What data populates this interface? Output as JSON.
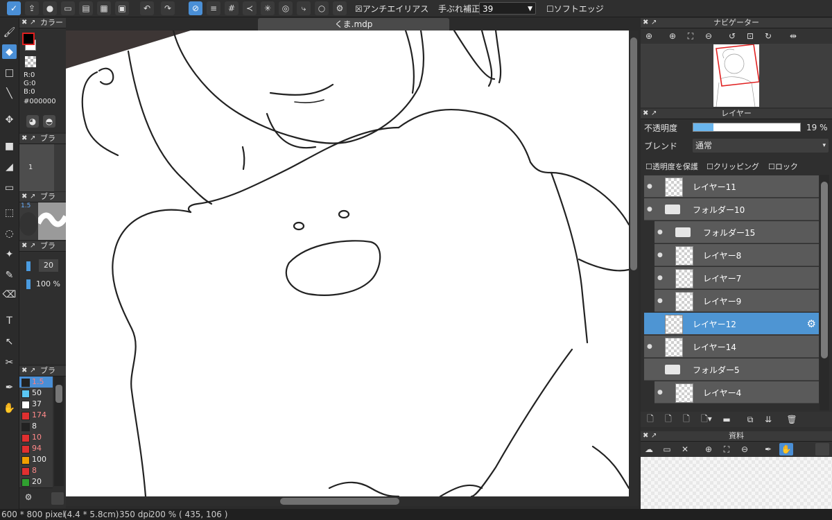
{
  "toolbar": {
    "antialias_label": "アンチエイリアス",
    "stabilizer_label": "手ぶれ補正",
    "stabilizer_value": "39",
    "soft_edge_label": "ソフトエッジ"
  },
  "document_tab": {
    "title": "くま.mdp"
  },
  "color_panel": {
    "title": "カラー",
    "r": "R:0",
    "g": "G:0",
    "b": "B:0",
    "hex": "#000000",
    "fg_color": "#000000",
    "bg_color": "#ffffff"
  },
  "brush_panels": {
    "title_1": "ブラ",
    "title_2": "ブラ",
    "title_3": "ブラ",
    "title_4": "ブラ",
    "size_marker": "1",
    "preview_label": "1.5",
    "size_value": "20",
    "opacity_value": "100 %"
  },
  "brush_list": [
    {
      "value": "1.5",
      "color": "#222222"
    },
    {
      "value": "50",
      "color": "#5bc8f5"
    },
    {
      "value": "37",
      "color": "#ffffff"
    },
    {
      "value": "174",
      "color": "#e03030"
    },
    {
      "value": "8",
      "color": "#222222"
    },
    {
      "value": "10",
      "color": "#e03030"
    },
    {
      "value": "94",
      "color": "#e03030"
    },
    {
      "value": "100",
      "color": "#f0a000"
    },
    {
      "value": "8",
      "color": "#e03030"
    },
    {
      "value": "20",
      "color": "#30a030"
    }
  ],
  "navigator": {
    "title": "ナビゲーター"
  },
  "layers_panel": {
    "title": "レイヤー",
    "opacity_label": "不透明度",
    "opacity_value": "19 %",
    "opacity_fraction": 0.19,
    "blend_label": "ブレンド",
    "blend_value": "通常",
    "protect_alpha": "透明度を保護",
    "clipping": "クリッピング",
    "lock": "ロック",
    "layers": [
      {
        "name": "レイヤー11",
        "kind": "layer",
        "indent": 0,
        "visible": true,
        "selected": false
      },
      {
        "name": "フォルダー10",
        "kind": "folder",
        "indent": 0,
        "visible": true,
        "selected": false
      },
      {
        "name": "フォルダー15",
        "kind": "folder",
        "indent": 1,
        "visible": true,
        "selected": false
      },
      {
        "name": "レイヤー8",
        "kind": "layer",
        "indent": 1,
        "visible": true,
        "selected": false
      },
      {
        "name": "レイヤー7",
        "kind": "layer",
        "indent": 1,
        "visible": true,
        "selected": false
      },
      {
        "name": "レイヤー9",
        "kind": "layer",
        "indent": 1,
        "visible": true,
        "selected": false
      },
      {
        "name": "レイヤー12",
        "kind": "layer",
        "indent": 0,
        "visible": false,
        "selected": true
      },
      {
        "name": "レイヤー14",
        "kind": "layer",
        "indent": 0,
        "visible": true,
        "selected": false
      },
      {
        "name": "フォルダー5",
        "kind": "folder",
        "indent": 0,
        "visible": false,
        "selected": false
      },
      {
        "name": "レイヤー4",
        "kind": "layer",
        "indent": 1,
        "visible": true,
        "selected": false
      }
    ]
  },
  "materials": {
    "title": "資料"
  },
  "status": {
    "size": "600 * 800 pixel",
    "physical": "(4.4 * 5.8cm)",
    "dpi": "350 dpi",
    "zoom": "200 %",
    "cursor": "( 435, 106 )"
  },
  "icons": [
    "medibang-logo",
    "share-icon",
    "speech-bubble-icon",
    "comment-icon",
    "page-icon",
    "panels-icon",
    "grid-icon",
    "undo-icon",
    "redo-icon",
    "snap-off-icon",
    "parallel-snap-icon",
    "grid-snap-icon",
    "perspective-snap-icon",
    "radial-snap-icon",
    "concentric-snap-icon",
    "curve-snap-icon",
    "ellipse-snap-icon",
    "settings-icon"
  ]
}
